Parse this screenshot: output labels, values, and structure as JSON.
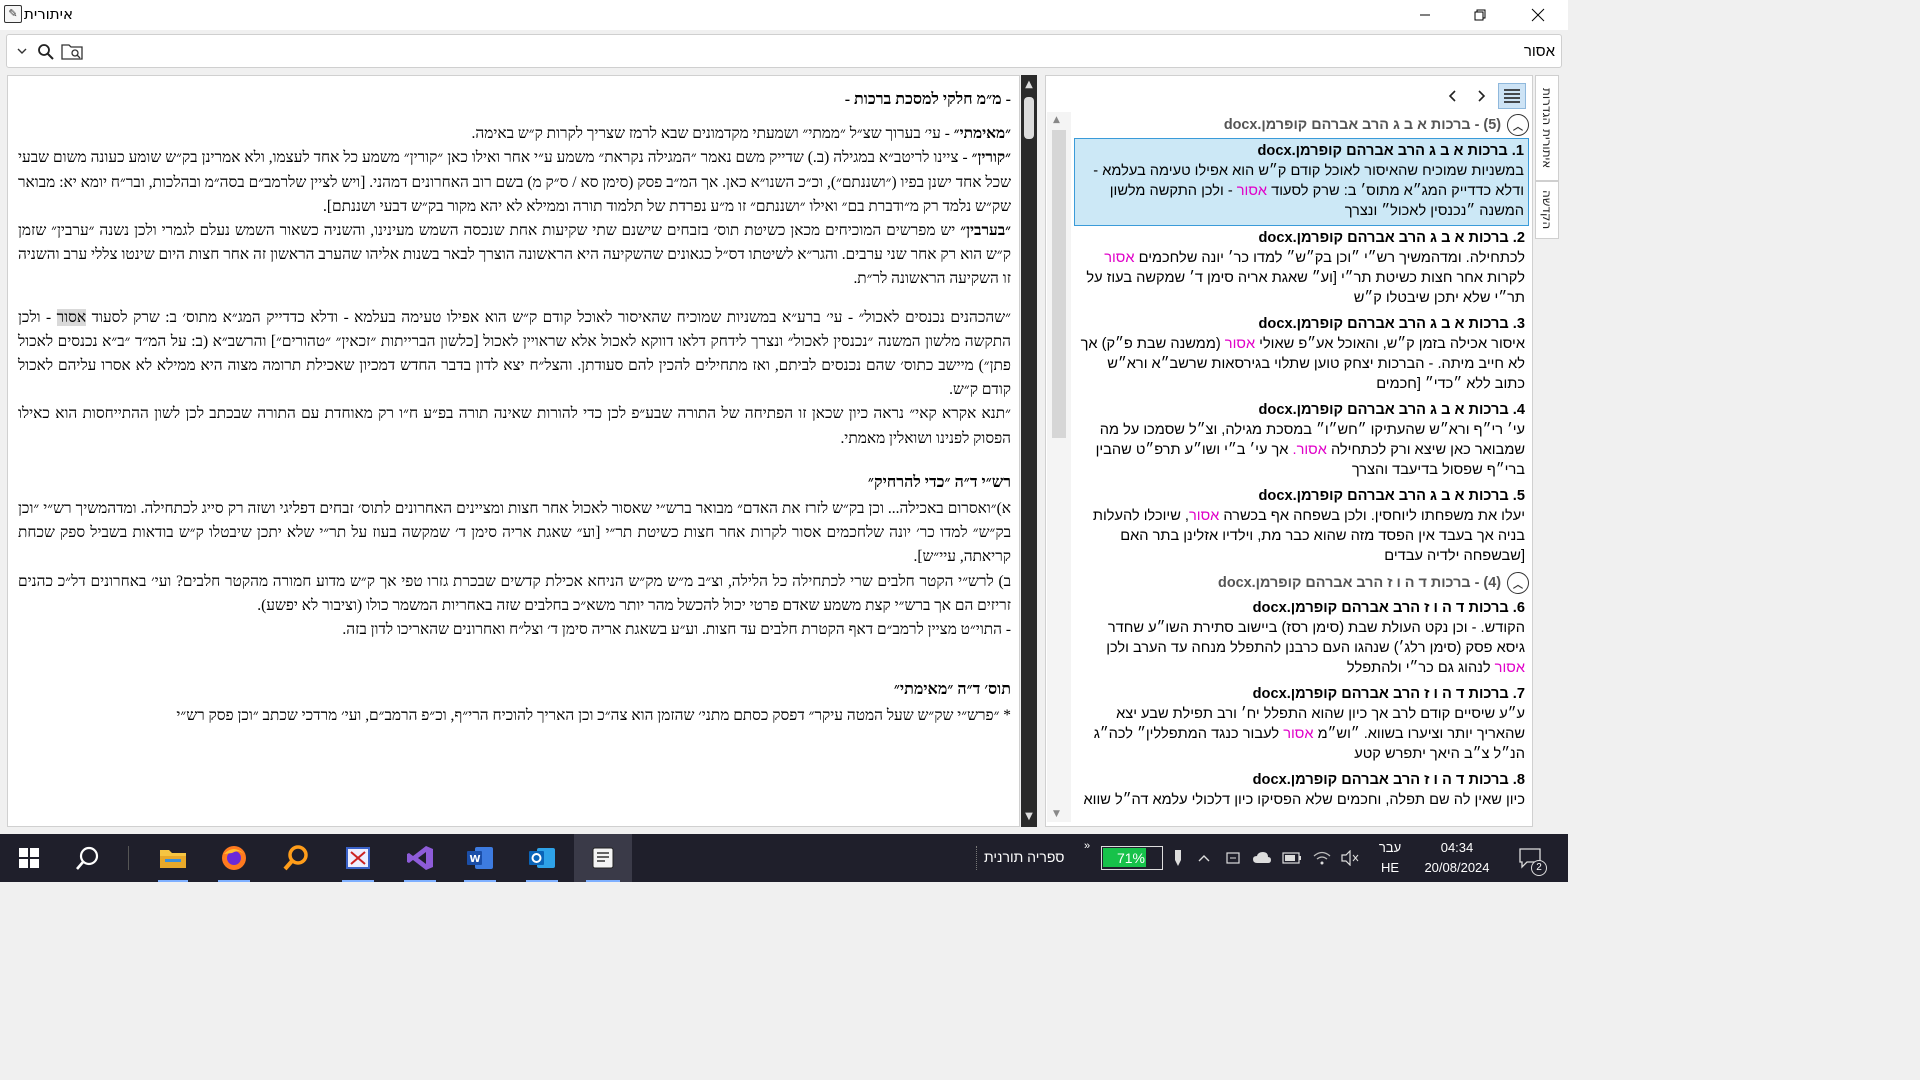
{
  "window": {
    "title": "איתורית"
  },
  "search": {
    "value": "אסור"
  },
  "document": {
    "heading": "- מ״מ חלקי למסכת ברכות -",
    "paras1": [
      {
        "b": "״מאימתי״",
        "t": " - עי׳ בערוך שצ״ל ״ממתי״ ושמעתי מקדמונים שבא לרמז שצריך לקרות ק״ש באימה."
      },
      {
        "b": "״קורין״",
        "t": " - ציינו לריטב״א במגילה (ב.) שדייק משם נאמר ״המגילה נקראת״ משמע ע״י אחר ואילו כאן ״קורין״ משמע כל אחד לעצמו, ולא אמרינן בק״ש שומע כעונה משום שבעי שכל אחד ישנן בפיו (״ושננתם״), וכ״כ השנו״א כאן. אך המ״ב פסק (סימן סא / ס״ק מ) בשם רוב האחרונים דמהני. [ויש לציין שלרמב״ם בסה״מ ובהלכות, ובר״ח יומא יא: מבואר שק״ש נלמד רק מ״ודברת בם״ ואילו ״ושננתם״ זו מ״ע נפרדת של תלמוד תורה וממילא לא יהא מקור בק״ש דבעי ושננתם]."
      },
      {
        "b": "״בערבין״",
        "t": " יש מפרשים המוכיחים מכאן כשיטת תוס׳ בזבחים שישנם שתי שקיעות אחת שנכסה השמש מעינינו, והשניה כשאור השמש נעלם לגמרי ולכן נשנה ״ערבין״ שזמן ק״ש הוא רק אחר שני ערבים. והגר״א לשיטתו דס״ל כגאונים שהשקיעה היא הראשונה הוצרך לבאר בשנות אליהו שהערב הראשון זה אחר חצות היום שינטו צללי ערב והשניה זו השקיעה הראשונה לר״ת."
      }
    ],
    "para_shekohanim_a": "״שהכהנים נכנסים לאכול״ - עי׳ ברע״א במשניות שמוכיח שהאיסור לאוכל קודם ק״ש הוא אפילו טעימה בעלמא - ודלא כדדייק המג״א מתוס׳ ב: שרק לסעוד",
    "para_shekohanim_kw": "אסור",
    "para_shekohanim_b": " - ולכן התקשה מלשון המשנה ״נכנסין לאכול״ ונצרך לידחק דלאו דווקא לאכול אלא שראויין לאכול [כלשון הברייתות ״זכאין״ ״טהורים״] והרשב״א (ב: על המ״ד ״ב״א נכנסים לאכול פתן״) מיישב כתוס׳ שהם נכנסים לביתם, ואז מתחילים להכין להם סעודתן. והצל״ח יצא לדון בדבר החדש דמכיון שאכילת תרומה מצוה היא ממילא לא אסרו עליהם לאכול קודם ק״ש.",
    "para_tanna": "״תנא אקרא קאי״ נראה כיון שכאן זו הפתיחה של התורה שבע״פ לכן כדי להורות שאינה תורה בפ״ע ח״ו רק מאוחדת עם התורה שבכתב לכן לשון ההתייחסות הוא כאילו הפסוק לפנינו ושואלין מאמתי.",
    "heading2": "רש״י ד״ה ״כדי להרחיק״",
    "paras2": [
      "א)״ואסרום באכילה... וכן בק״ש לזרז את האדם״ מבואר ברש״י שאסור לאכול אחר חצות ומציינים האחרונים לתוס׳ זבחים דפליגי ושזה רק סייג לכתחילה. ומדהמשיך רש״י ״וכן בק״ש״ למדו כר׳ יונה שלחכמים אסור לקרות אחר חצות כשיטת תר״י [וע״ שאגת אריה סימן ד׳ שמקשה בעוז על תר״י שלא יתכן שיבטלו ק״ש בודאות בשביל ספק שכחת קריאתה, עיי״ש].",
      "ב) לרש״י הקטר חלבים שרי לכתחילה כל הלילה, וצ״ב מ״ש מק״ש הניחא אכילת קדשים שבכרת גזרו טפי אך ק״ש מדוע חמורה מהקטר חלבים? ועי׳ באחרונים דל״כ כהנים זריזים הם אך ברש״י קצת משמע שאדם פרטי יכול להכשל מהר יותר משא״כ בחלבים שזה באחריות המשמר כולו (וציבור לא יפשע).",
      "- התוי״ט מציין לרמב״ם דאף הקטרת חלבים עד חצות. וע״ע בשאגת אריה סימן ד׳ וצל״ח ואחרונים שהאריכו לדון בזה."
    ],
    "heading3": "תוס׳ ד״ה ״מאימתי״",
    "para_last": "* ״פרש״י שק״ש שעל המטה עיקר״ דפסק כסתם מתני׳ שהזמן הוא צה״כ וכן האריך להוכיח הרי״ף, וכ״פ הרמב״ם, ועי׳ מרדכי שכתב ״וכן פסק רש״י"
  },
  "results": {
    "groups": [
      {
        "title": "(5) - ברכות א ב ג הרב אברהם קופרמן.docx",
        "items": [
          {
            "title": "1. ברכות א ב ג הרב אברהם קופרמן.docx",
            "pre": "במשניות שמוכיח שהאיסור לאוכל קודם ק״ש הוא אפילו טעימה בעלמא - ודלא כדדייק המג״א מתוס׳ ב: שרק לסעוד ",
            "kw": "אסור",
            "post": " - ולכן התקשה מלשון המשנה ״נכנסין לאכול״ ונצרך"
          },
          {
            "title": "2. ברכות א ב ג הרב אברהם קופרמן.docx",
            "pre": "לכתחילה. ומדהמשיך רש״י ״וכן בק״ש״ למדו כר׳ יונה שלחכמים ",
            "kw": "אסור",
            "post": " לקרות אחר חצות כשיטת תר״י [וע״ שאגת אריה סימן ד׳ שמקשה בעוז על תר״י שלא יתכן שיבטלו ק״ש"
          },
          {
            "title": "3. ברכות א ב ג הרב אברהם קופרמן.docx",
            "pre": "איסור אכילה בזמן ק״ש, והאוכל אע״פ שאולי ",
            "kw": "אסור",
            "post": " (ממשנה שבת פ״ק) אך לא חייב מיתה. - הברכות יצחק טוען שתלוי בגירסאות שרשב״א ורא״ש כתוב ללא ״כדי״ [חכמים"
          },
          {
            "title": "4. ברכות א ב ג הרב אברהם קופרמן.docx",
            "pre": "עי׳ רי״ף ורא״ש שהעתיקו ״חש״ו״ במסכת מגילה, וצ״ל שסמכו על מה שמבואר כאן שיצא ורק לכתחילה ",
            "kw": "אסור.",
            "post": " אך עי׳ ב״י ושו״ע תרפ״ט שהבין ברי״ף שפסול בדיעבד והצרך"
          },
          {
            "title": "5. ברכות א ב ג הרב אברהם קופרמן.docx",
            "pre": "יעלו את משפחתו ליוחסין. ולכן בשפחה אף בכשרה ",
            "kw": "אסור",
            "post": ", שיוכלו להעלות בניה אך בעבד אין הפסד מזה שהוא כבר מת, וילדיו אזלינן בתר האם [שבשפחה ילדיה עבדים"
          }
        ]
      },
      {
        "title": "(4) - ברכות ד ה ו ז הרב אברהם קופרמן.docx",
        "items": [
          {
            "title": "6. ברכות ד ה ו ז הרב אברהם קופרמן.docx",
            "pre": "הקודש. - וכן נקט העולת שבת (סימן רסז) ביישוב סתירת השו״ע שחדר גיסא פסק (סימן רלג׳) שנהגו העם כרבנן להתפלל מנחה עד הערב ולכן ",
            "kw": "אסור",
            "post": " לנהוג גם כר״י ולהתפלל"
          },
          {
            "title": "7. ברכות ד ה ו ז הרב אברהם קופרמן.docx",
            "pre": "ע״ע שיסיים קודם לרב אך כיון שהוא התפלל יח׳ ורב תפילת שבע יצא שהאריך יותר וציערו בשווא. ״וש״מ ",
            "kw": "אסור",
            "post": " לעבור כנגד המתפללין״ לכה״ג הנ״ל צ״ב היאך יתפרש קטע"
          },
          {
            "title": "8. ברכות ד ה ו ז הרב אברהם קופרמן.docx",
            "pre": "כיון שאין לה שם תפלה, וחכמים שלא הפסיקו כיון דלכולי עלמא דה״ל שווא",
            "kw": "",
            "post": ""
          }
        ]
      }
    ]
  },
  "side_tabs": [
    "איתורית הגדרות",
    "הקדשה"
  ],
  "taskbar": {
    "toolbar_label": "ספריה תורנית",
    "battery": "71%",
    "lang_top": "עבר",
    "lang_bottom": "HE",
    "time": "04:34",
    "date": "20/08/2024",
    "notif_count": "2"
  },
  "colors": {
    "keyword": "#e000c8",
    "selected_bg": "#cce8f6",
    "selected_border": "#3a9bd9",
    "taskbar": "#1f1f2b"
  }
}
